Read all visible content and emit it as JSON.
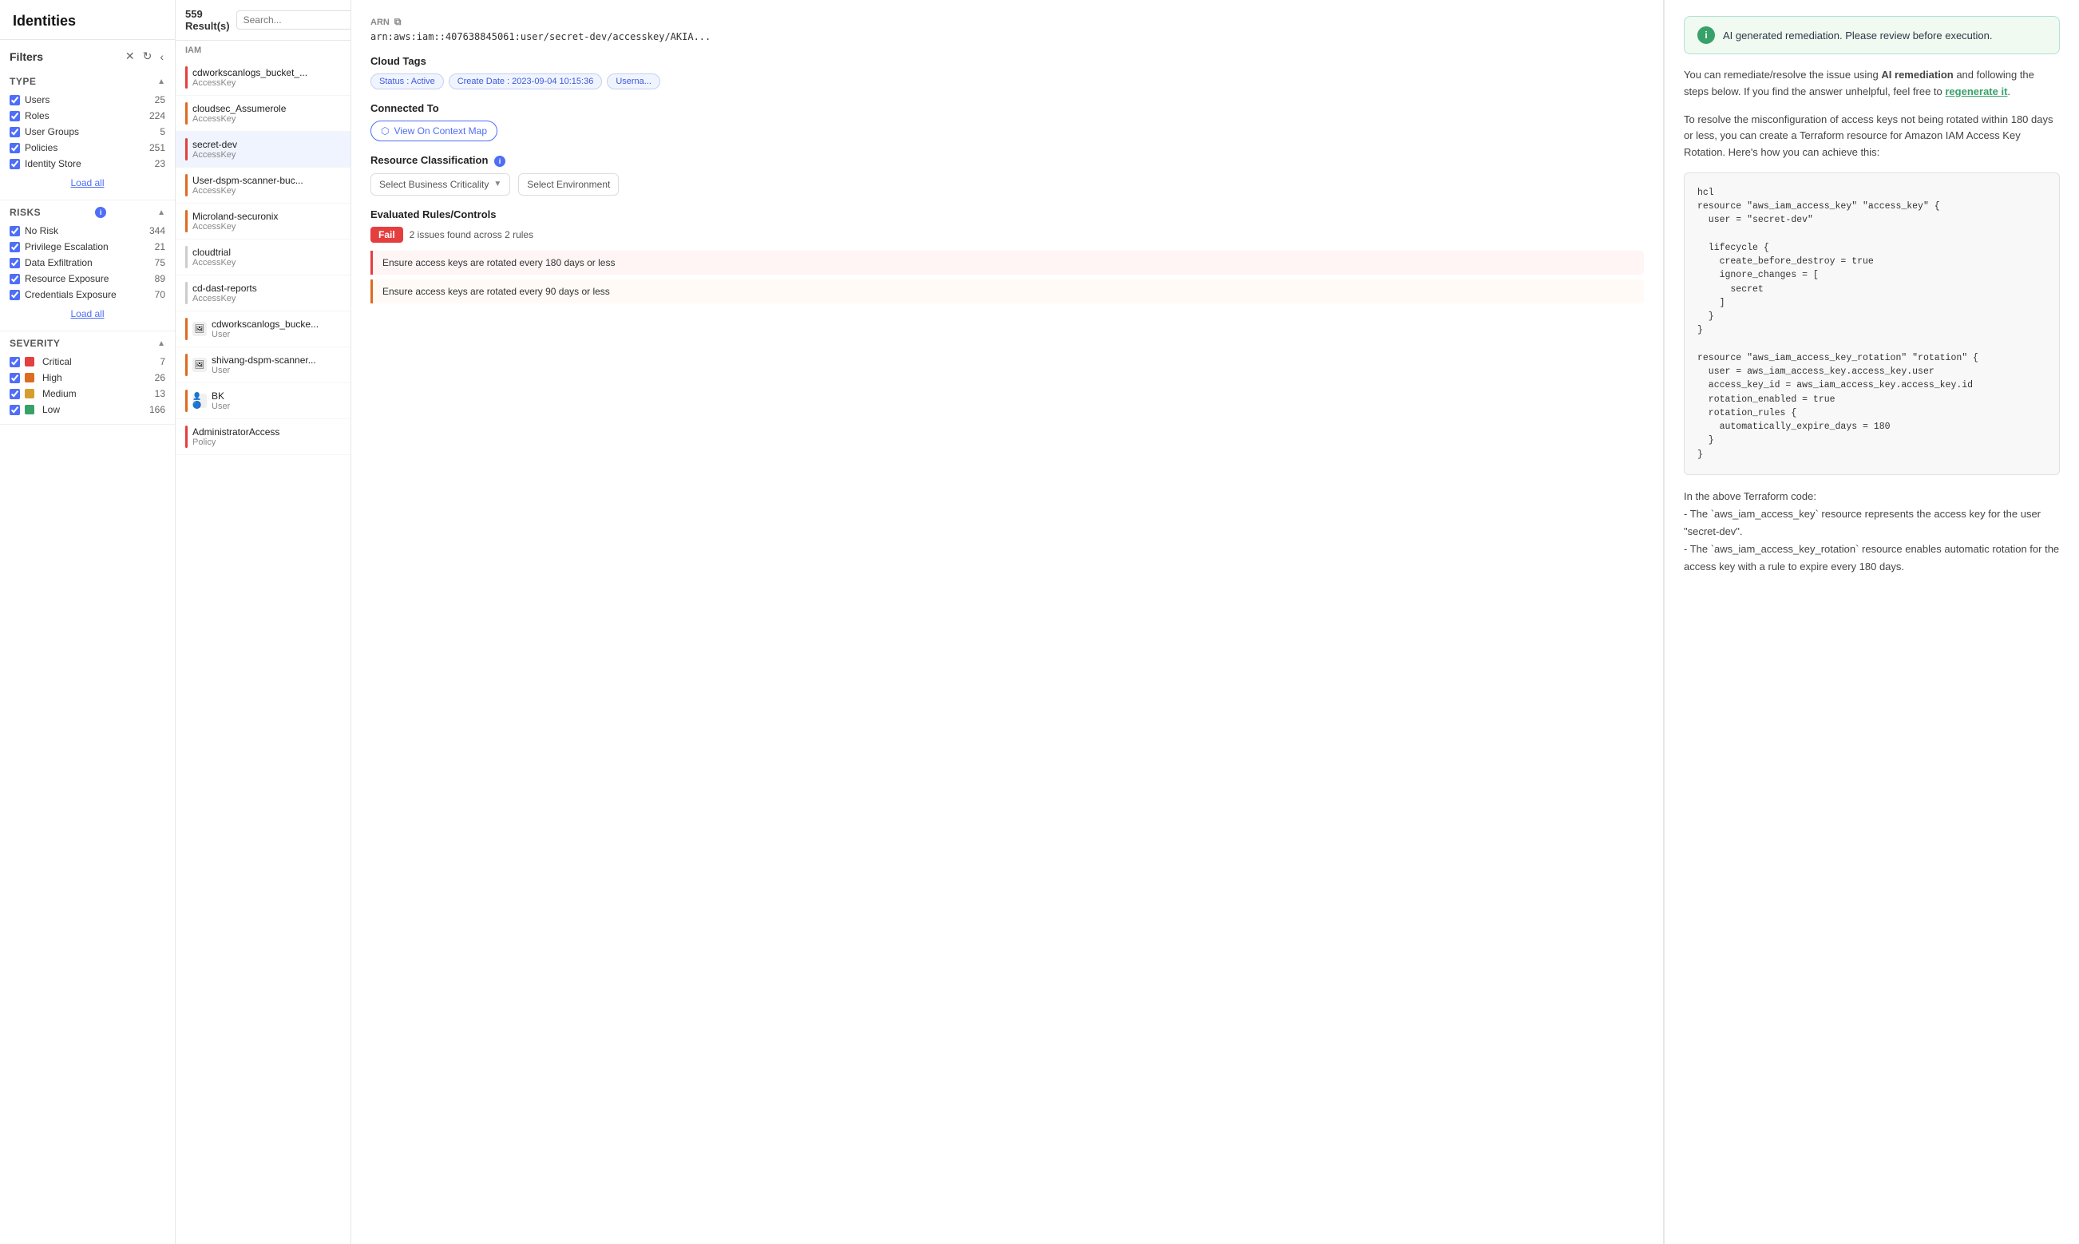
{
  "sidebar": {
    "title": "Identities",
    "filters": {
      "title": "Filters",
      "type_section": {
        "label": "Type",
        "items": [
          {
            "label": "Users",
            "count": 25,
            "checked": true
          },
          {
            "label": "Roles",
            "count": 224,
            "checked": true
          },
          {
            "label": "User Groups",
            "count": 5,
            "checked": true
          },
          {
            "label": "Policies",
            "count": 251,
            "checked": true
          },
          {
            "label": "Identity Store",
            "count": 23,
            "checked": true
          }
        ],
        "load_all": "Load all"
      },
      "risks_section": {
        "label": "Risks",
        "items": [
          {
            "label": "No Risk",
            "count": 344,
            "checked": true
          },
          {
            "label": "Privilege Escalation",
            "count": 21,
            "checked": true
          },
          {
            "label": "Data Exfiltration",
            "count": 75,
            "checked": true
          },
          {
            "label": "Resource Exposure",
            "count": 89,
            "checked": true
          },
          {
            "label": "Credentials Exposure",
            "count": 70,
            "checked": true
          }
        ],
        "load_all": "Load all"
      },
      "severity_section": {
        "label": "Severity",
        "items": [
          {
            "label": "Critical",
            "count": 7,
            "checked": true,
            "color": "critical"
          },
          {
            "label": "High",
            "count": 26,
            "checked": true,
            "color": "high"
          },
          {
            "label": "Medium",
            "count": 13,
            "checked": true,
            "color": "medium"
          },
          {
            "label": "Low",
            "count": 166,
            "checked": true,
            "color": "low"
          }
        ]
      }
    }
  },
  "middle": {
    "results_count": "559 Result(s)",
    "search_placeholder": "Search...",
    "iam_label": "IAM",
    "items": [
      {
        "name": "cdworkscanlogs_bucket_...",
        "type": "AccessKey",
        "severity": "red"
      },
      {
        "name": "cloudsec_Assumerole",
        "type": "AccessKey",
        "severity": "orange"
      },
      {
        "name": "secret-dev",
        "type": "AccessKey",
        "severity": "red"
      },
      {
        "name": "User-dspm-scanner-buc...",
        "type": "AccessKey",
        "severity": "orange"
      },
      {
        "name": "Microland-securonix",
        "type": "AccessKey",
        "severity": "orange"
      },
      {
        "name": "cloudtrial",
        "type": "AccessKey",
        "severity": "gray"
      },
      {
        "name": "cd-dast-reports",
        "type": "AccessKey",
        "severity": "gray"
      },
      {
        "name": "cdworkscanlogs_bucke...",
        "type": "User",
        "severity": "orange"
      },
      {
        "name": "shivang-dspm-scanner...",
        "type": "User",
        "severity": "orange"
      },
      {
        "name": "BK",
        "type": "User",
        "severity": "orange"
      },
      {
        "name": "AdministratorAccess",
        "type": "Policy",
        "severity": "red"
      }
    ]
  },
  "detail": {
    "arn_label": "ARN",
    "arn_value": "arn:aws:iam::407638845061:user/secret-dev/accesskey/AKIA...",
    "cloud_tags_title": "Cloud Tags",
    "tags": [
      {
        "text": "Status : Active"
      },
      {
        "text": "Create Date : 2023-09-04 10:15:36"
      },
      {
        "text": "Userna..."
      }
    ],
    "connected_to_title": "Connected To",
    "context_map_btn": "View On Context Map",
    "resource_classification_title": "Resource Classification",
    "select_business_criticality": "Select Business Criticality",
    "select_environment": "Select Environment",
    "evaluated_rules_title": "Evaluated Rules/Controls",
    "fail_label": "Fail",
    "issues_text": "2 issues found across 2 rules",
    "rules": [
      {
        "text": "Ensure access keys are rotated every 180 days or less",
        "color": "red"
      },
      {
        "text": "Ensure access keys are rotated every 90 days or less",
        "color": "orange"
      }
    ]
  },
  "ai_panel": {
    "banner_text": "AI generated remediation. Please review before execution.",
    "intro_text": "You can remediate/resolve the issue using ",
    "ai_remediation_bold": "AI remediation",
    "intro_text2": " and following the steps below. If you find the answer unhelpful, feel free to ",
    "regenerate_link": "regenerate it",
    "intro_text3": ".",
    "description": "To resolve the misconfiguration of access keys not being rotated within 180 days or less, you can create a Terraform resource for Amazon IAM Access Key Rotation. Here's how you can achieve this:",
    "code": "hcl\nresource \"aws_iam_access_key\" \"access_key\" {\n  user = \"secret-dev\"\n\n  lifecycle {\n    create_before_destroy = true\n    ignore_changes = [\n      secret\n    ]\n  }\n}\n\nresource \"aws_iam_access_key_rotation\" \"rotation\" {\n  user = aws_iam_access_key.access_key.user\n  access_key_id = aws_iam_access_key.access_key.id\n  rotation_enabled = true\n  rotation_rules {\n    automatically_expire_days = 180\n  }\n}",
    "explanation_title": "In the above Terraform code:",
    "explanation_lines": [
      "- The `aws_iam_access_key` resource represents the access key for the user \"secret-dev\".",
      "- The `aws_iam_access_key_rotation` resource enables automatic rotation for the access key with a rule to expire every 180 days."
    ]
  }
}
